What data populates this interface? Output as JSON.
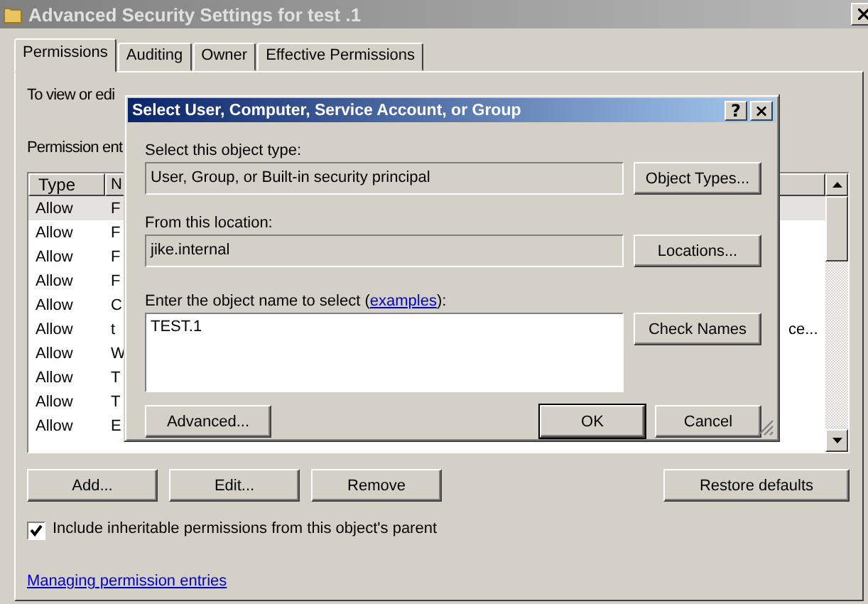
{
  "window": {
    "title": "Advanced Security Settings for test .1"
  },
  "tabs": [
    {
      "label": "Permissions",
      "selected": true
    },
    {
      "label": "Auditing",
      "selected": false
    },
    {
      "label": "Owner",
      "selected": false
    },
    {
      "label": "Effective Permissions",
      "selected": false
    }
  ],
  "instructions": "To view or edi",
  "entries_label": "Permission ent",
  "table": {
    "columns": [
      "Type",
      "N"
    ],
    "rows": [
      {
        "type": "Allow",
        "column_2": "F",
        "selected": true
      },
      {
        "type": "Allow",
        "column_2": "F",
        "selected": false
      },
      {
        "type": "Allow",
        "column_2": "F",
        "selected": false
      },
      {
        "type": "Allow",
        "column_2": "F",
        "selected": false
      },
      {
        "type": "Allow",
        "column_2": "C",
        "selected": false
      },
      {
        "type": "Allow",
        "column_2": "t",
        "column_3": "ce...",
        "selected": false
      },
      {
        "type": "Allow",
        "column_2": "W",
        "selected": false
      },
      {
        "type": "Allow",
        "column_2": "T",
        "selected": false
      },
      {
        "type": "Allow",
        "column_2": "T",
        "selected": false
      },
      {
        "type": "Allow",
        "column_2": "E",
        "selected": false
      }
    ]
  },
  "buttons": [
    "Add...",
    "Edit...",
    "Remove"
  ],
  "restore_button": "Restore defaults",
  "inherit": {
    "label": "Include inheritable permissions from this object's parent",
    "checked": true
  },
  "link": "Managing permission entries",
  "dialog": {
    "title": "Select User, Computer, Service Account, or Group",
    "help_button": "?",
    "close_button": "×",
    "object_type_label": "Select this object type:",
    "object_type": "User, Group, or Built-in security principal",
    "object_types_button": "Object Types...",
    "location_label": "From this location:",
    "location": "jike.internal",
    "locations_button": "Locations...",
    "name_label": {
      "text": "Enter the object name to select (",
      "link": "examples",
      "after": "):"
    },
    "name_value": "TEST.1",
    "check_names_button": "Check Names",
    "advanced_button": "Advanced...",
    "ok_button": "OK",
    "cancel_button": "Cancel"
  }
}
